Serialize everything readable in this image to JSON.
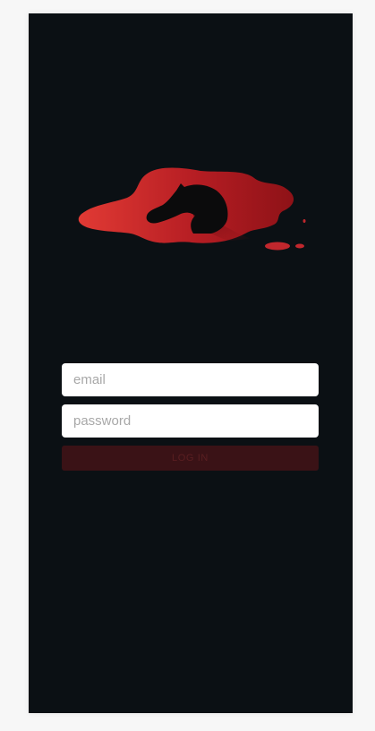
{
  "app": {
    "logo_icon": "horse-head-blood-logo-icon",
    "background_color": "#0b1014",
    "accent_color": "#c1272d"
  },
  "login_form": {
    "email_placeholder": "email",
    "email_value": "",
    "password_placeholder": "password",
    "password_value": "",
    "login_label": "LOG IN",
    "login_button_color": "#3a1216"
  }
}
